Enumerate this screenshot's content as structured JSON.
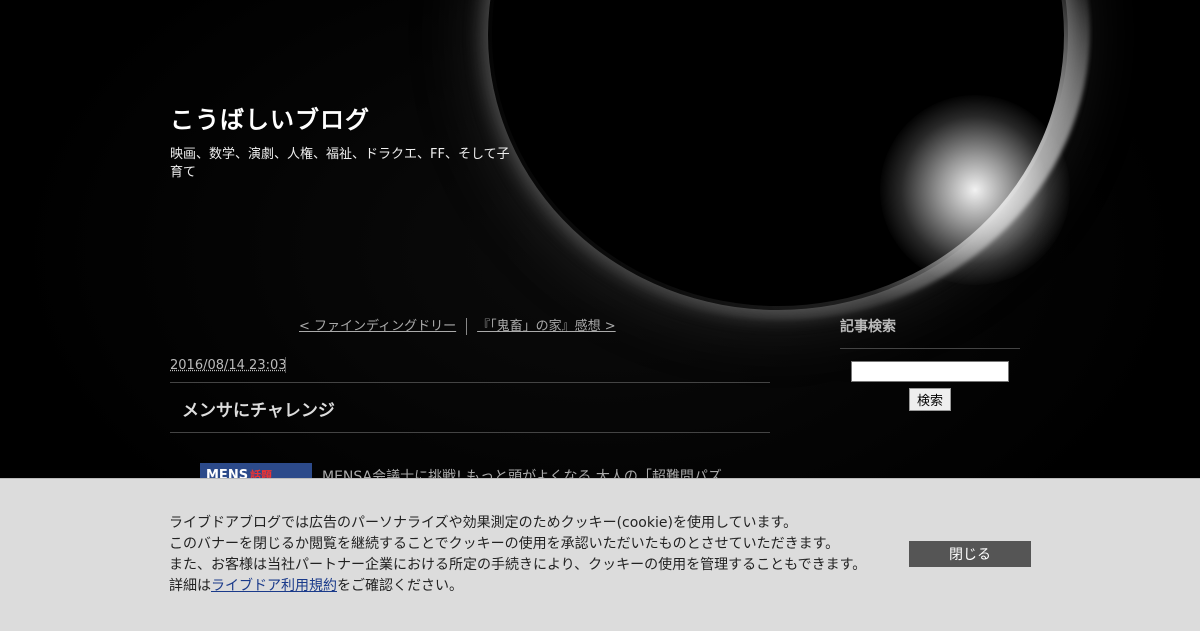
{
  "header": {
    "title": "こうばしいブログ",
    "description": "映画、数学、演劇、人権、福祉、ドラクエ、FF、そして子育て"
  },
  "pager": {
    "prev": "< ファインディングドリー",
    "next": "『「鬼畜」の家』感想 >"
  },
  "post": {
    "date": "2016/08/14 23:03",
    "title": "メンサにチャレンジ",
    "thumbnail_text": "MENS",
    "thumbnail_badge": "話題",
    "excerpt": "MENSA会議士に挑戦! もっと頭がよくなる 大人の「超難問パズ"
  },
  "sidebar": {
    "search_title": "記事検索",
    "search_value": "",
    "search_button": "検索"
  },
  "cookie_banner": {
    "line1": "ライブドアブログでは広告のパーソナライズや効果測定のためクッキー(cookie)を使用しています。",
    "line2": "このバナーを閉じるか閲覧を継続することでクッキーの使用を承認いただいたものとさせていただきます。",
    "line3": "また、お客様は当社パートナー企業における所定の手続きにより、クッキーの使用を管理することもできます。",
    "line4_prefix": "詳細は",
    "line4_link": "ライブドア利用規約",
    "line4_suffix": "をご確認ください。",
    "close_label": "閉じる"
  },
  "colors": {
    "background": "#000000",
    "banner_bg": "#dcdcdc",
    "close_button": "#555555",
    "link": "#1a3a8a"
  }
}
